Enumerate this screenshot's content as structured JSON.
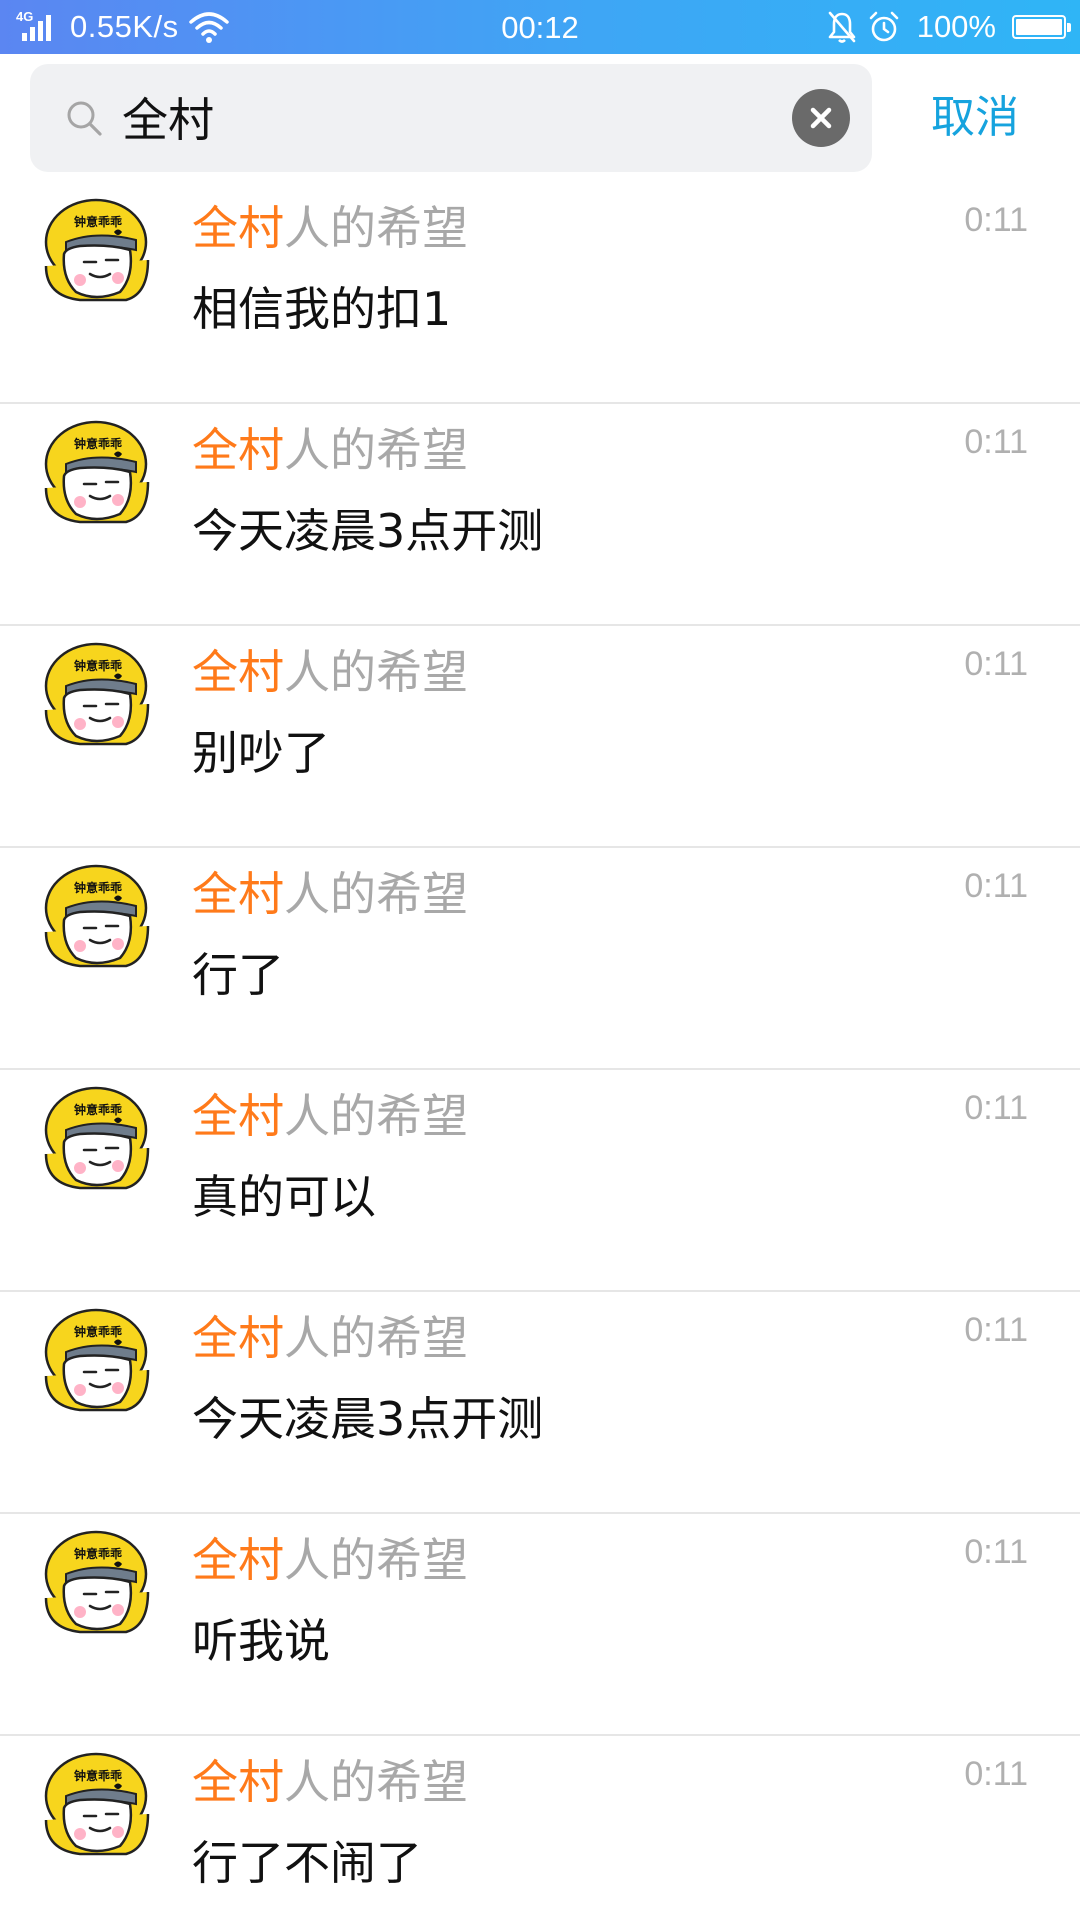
{
  "status_bar": {
    "network_label": "4G",
    "speed": "0.55K/s",
    "time": "00:12",
    "battery": "100%",
    "battery_level": 1.0,
    "icons": [
      "signal-icon",
      "wifi-icon",
      "notifications-off-icon",
      "alarm-icon",
      "battery-icon"
    ]
  },
  "search": {
    "query": "全村",
    "placeholder": "",
    "cancel_label": "取消"
  },
  "colors": {
    "status_bar_gradient": [
      "#5b86f2",
      "#2fb5f6"
    ],
    "highlight": "#ff7a1a",
    "cancel": "#16a3de",
    "title_gray": "#a8a8a8",
    "text": "#111111"
  },
  "results": [
    {
      "title_highlight": "全村",
      "title_rest": "人的希望",
      "time": "0:11",
      "message": "相信我的扣1"
    },
    {
      "title_highlight": "全村",
      "title_rest": "人的希望",
      "time": "0:11",
      "message": "今天凌晨3点开测"
    },
    {
      "title_highlight": "全村",
      "title_rest": "人的希望",
      "time": "0:11",
      "message": "别吵了"
    },
    {
      "title_highlight": "全村",
      "title_rest": "人的希望",
      "time": "0:11",
      "message": "行了"
    },
    {
      "title_highlight": "全村",
      "title_rest": "人的希望",
      "time": "0:11",
      "message": "真的可以"
    },
    {
      "title_highlight": "全村",
      "title_rest": "人的希望",
      "time": "0:11",
      "message": "今天凌晨3点开测"
    },
    {
      "title_highlight": "全村",
      "title_rest": "人的希望",
      "time": "0:11",
      "message": "听我说"
    },
    {
      "title_highlight": "全村",
      "title_rest": "人的希望",
      "time": "0:11",
      "message": "行了不闹了"
    }
  ],
  "avatar": {
    "helmet_text": "钟意乖乖",
    "helmet_color": "#f7d51d"
  }
}
